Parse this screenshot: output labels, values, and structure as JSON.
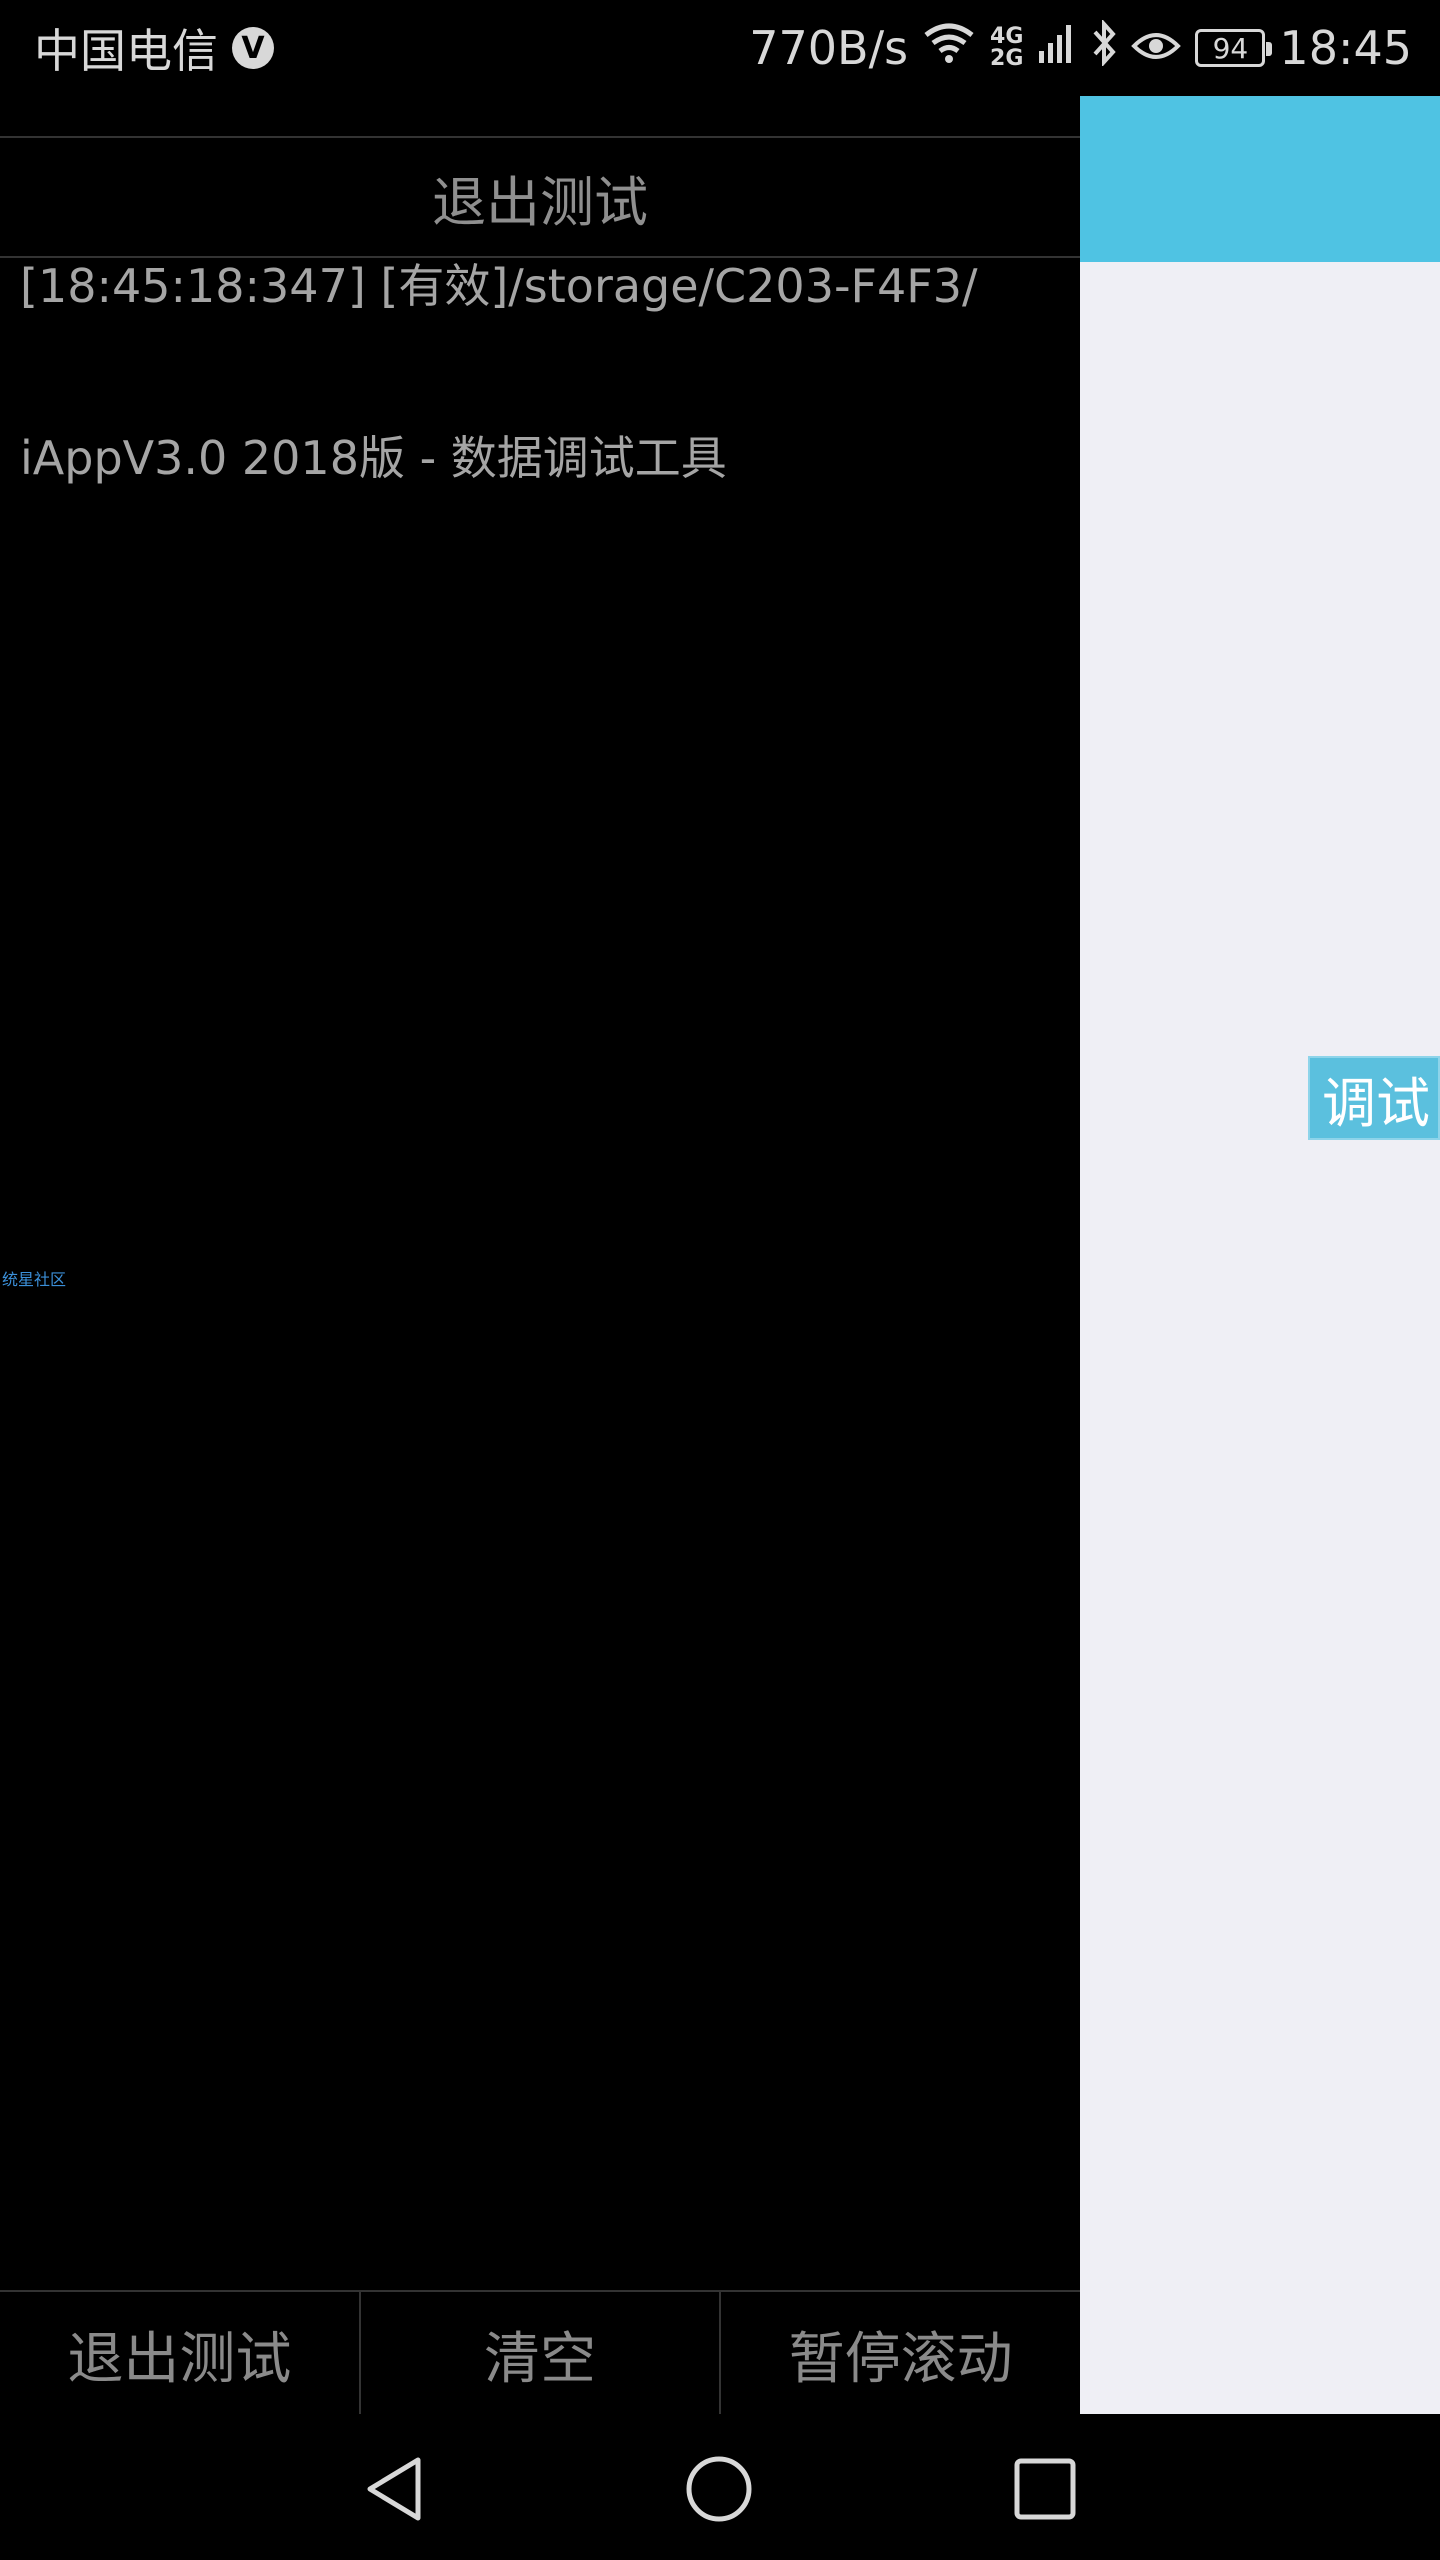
{
  "status_bar": {
    "carrier": "中国电信",
    "carrier_badge": "V",
    "net_rate": "770B/s",
    "net_type_top": "4G",
    "net_type_bottom": "2G",
    "battery_level": "94",
    "time": "18:45",
    "icons": [
      "wifi-icon",
      "signal-icon",
      "bluetooth-icon",
      "eye-icon",
      "battery-icon"
    ]
  },
  "console": {
    "top_exit_label": "退出测试",
    "log_lines": [
      "[18:45:18:347]  [有效]/storage/C203-F4F3/",
      "iAppV3.0 2018版 - 数据调试工具"
    ],
    "watermark": "统星社区",
    "bottom_buttons": [
      "退出测试",
      "清空",
      "暂停滚动"
    ]
  },
  "app_panel": {
    "debug_tag": "调试",
    "header_color": "#4fc3e3",
    "background_color": "#efeff5"
  },
  "navbar": {
    "icons": [
      "back-icon",
      "home-icon",
      "recents-icon"
    ]
  }
}
